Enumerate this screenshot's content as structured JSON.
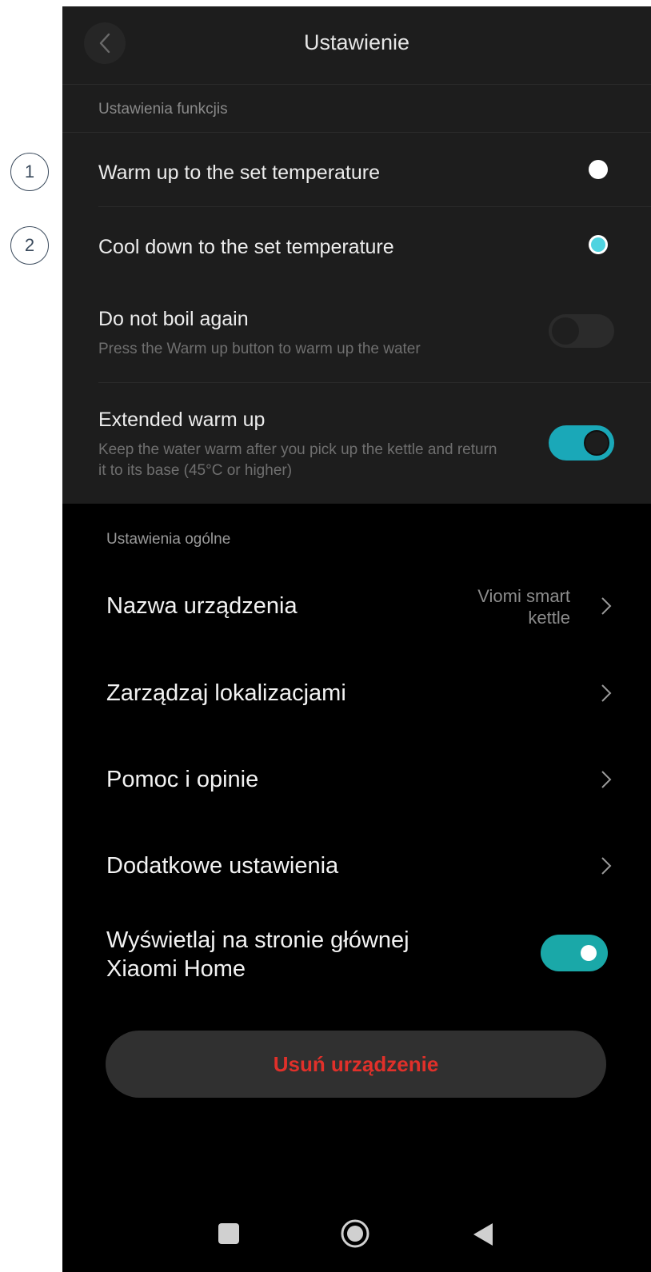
{
  "annotations": [
    "1",
    "2"
  ],
  "header": {
    "title": "Ustawienie",
    "back_icon": "chevron-left-icon"
  },
  "function_settings": {
    "section_label": "Ustawienia funkcjis",
    "options": [
      {
        "label": "Warm up to the set temperature",
        "selected": false
      },
      {
        "label": "Cool down to the set temperature",
        "selected": true
      }
    ],
    "do_not_boil": {
      "label": "Do not boil again",
      "description": "Press the Warm up button to warm up the water",
      "enabled": false
    },
    "extended_warm": {
      "label": "Extended warm up",
      "description_line1": "Keep the water warm after you pick up the kettle and return",
      "description_line2": "it to its base (45°C or higher)",
      "enabled": true
    }
  },
  "general_settings": {
    "section_label": "Ustawienia ogólne",
    "device_name": {
      "label": "Nazwa urządzenia",
      "value_line1": "Viomi smart",
      "value_line2": "kettle"
    },
    "manage_locations": {
      "label": "Zarządzaj lokalizacjami"
    },
    "help": {
      "label": "Pomoc i opinie"
    },
    "additional": {
      "label": "Dodatkowe ustawienia"
    },
    "show_home": {
      "label_line1": "Wyświetlaj na stronie głównej",
      "label_line2": "Xiaomi Home",
      "enabled": true
    }
  },
  "remove_button": {
    "label": "Usuń urządzenie"
  },
  "navbar": {
    "icons": [
      "recents-square-icon",
      "home-circle-icon",
      "back-triangle-icon"
    ]
  },
  "colors": {
    "accent": "#1aa8b8",
    "radio_selected": "#4fd3e0",
    "danger": "#e0302a"
  }
}
